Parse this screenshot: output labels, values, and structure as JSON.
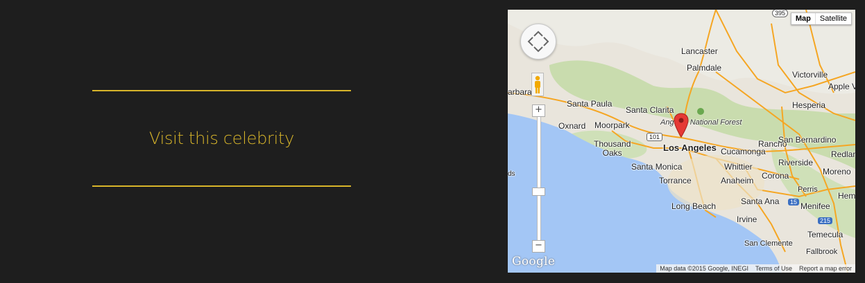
{
  "left_panel": {
    "title": "Visit this celebrity"
  },
  "map": {
    "type_buttons": [
      "Map",
      "Satellite"
    ],
    "active_type": "Map",
    "places": {
      "lancaster": "Lancaster",
      "palmdale": "Palmdale",
      "victorville": "Victorville",
      "apple_valley": "Apple V",
      "hesperia": "Hesperia",
      "santa_barbara": "arbara",
      "santa_paula": "Santa Paula",
      "santa_clarita": "Santa Clarita",
      "angeles_nf": "Angeles National Forest",
      "oxnard": "Oxnard",
      "moorpark": "Moorpark",
      "thousand_oaks": "Thousand\nOaks",
      "los_angeles": "Los Angeles",
      "rancho": "Rancho",
      "cucamonga": "Cucamonga",
      "san_bernardino": "San Bernardino",
      "redlands": "Redland",
      "santa_monica": "Santa Monica",
      "whittier": "Whittier",
      "riverside": "Riverside",
      "moreno": "Moreno",
      "torrance": "Torrance",
      "anaheim": "Anaheim",
      "corona": "Corona",
      "perris": "Perris",
      "hem": "Hem",
      "long_beach": "Long Beach",
      "santa_ana": "Santa Ana",
      "menifee": "Menifee",
      "irvine": "Irvine",
      "temecula": "Temecula",
      "san_clemente": "San Clemente",
      "fallbrook": "Fallbrook",
      "ds": "ds"
    },
    "shields": {
      "i395": "395",
      "us101": "101",
      "i15": "15",
      "i215": "215"
    },
    "logo": "Google",
    "footer": {
      "data": "Map data ©2015 Google, INEGI",
      "terms": "Terms of Use",
      "report": "Report a map error"
    },
    "colors": {
      "water": "#a3c6f5",
      "land": "#e9e5dc",
      "park": "#c8dcae",
      "highway": "#f5a623",
      "marker": "#e53935"
    },
    "icons": {
      "marker": "map-pin-icon",
      "pegman": "pegman-icon",
      "pan": "pan-control-icon"
    }
  }
}
